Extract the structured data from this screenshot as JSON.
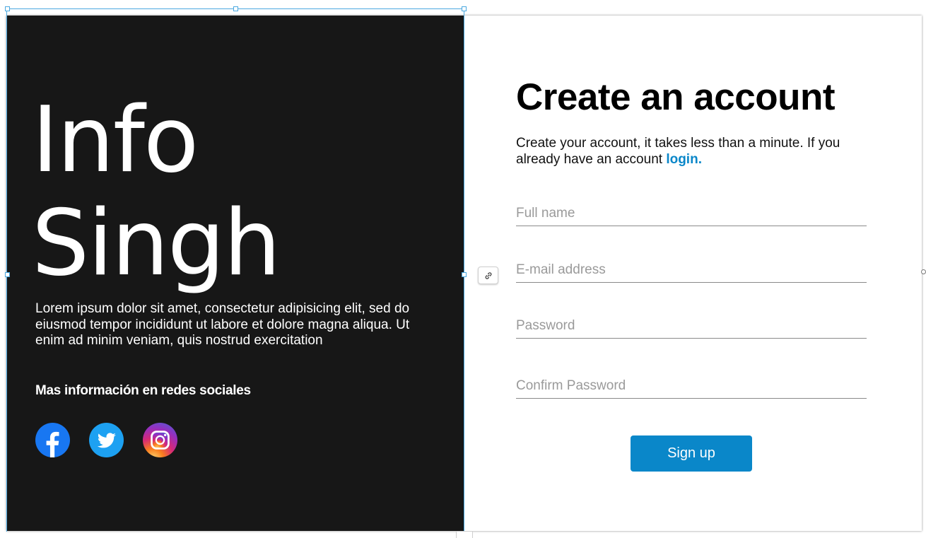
{
  "brand": {
    "line1": "Info",
    "line2": "Singh"
  },
  "description": "Lorem ipsum dolor sit amet, consectetur adipisicing elit, sed do eiusmod tempor incididunt ut labore et dolore magna aliqua. Ut enim ad minim veniam, quis nostrud exercitation",
  "social": {
    "heading": "Mas información en redes sociales",
    "icons": [
      "facebook-icon",
      "twitter-icon",
      "instagram-icon"
    ],
    "colors": {
      "facebook": "#1877f2",
      "twitter": "#1da1f2"
    }
  },
  "form": {
    "title": "Create an account",
    "subtitle_text": "Create your account, it takes less than a minute. If you already have an account ",
    "login_link": "login.",
    "fields": {
      "full_name_placeholder": "Full name",
      "email_placeholder": "E-mail address",
      "password_placeholder": "Password",
      "confirm_password_placeholder": "Confirm Password"
    },
    "submit_label": "Sign up"
  },
  "theme": {
    "left_bg": "#171717",
    "accent": "#0a87c9"
  },
  "editor": {
    "link_icon": "link-icon"
  }
}
